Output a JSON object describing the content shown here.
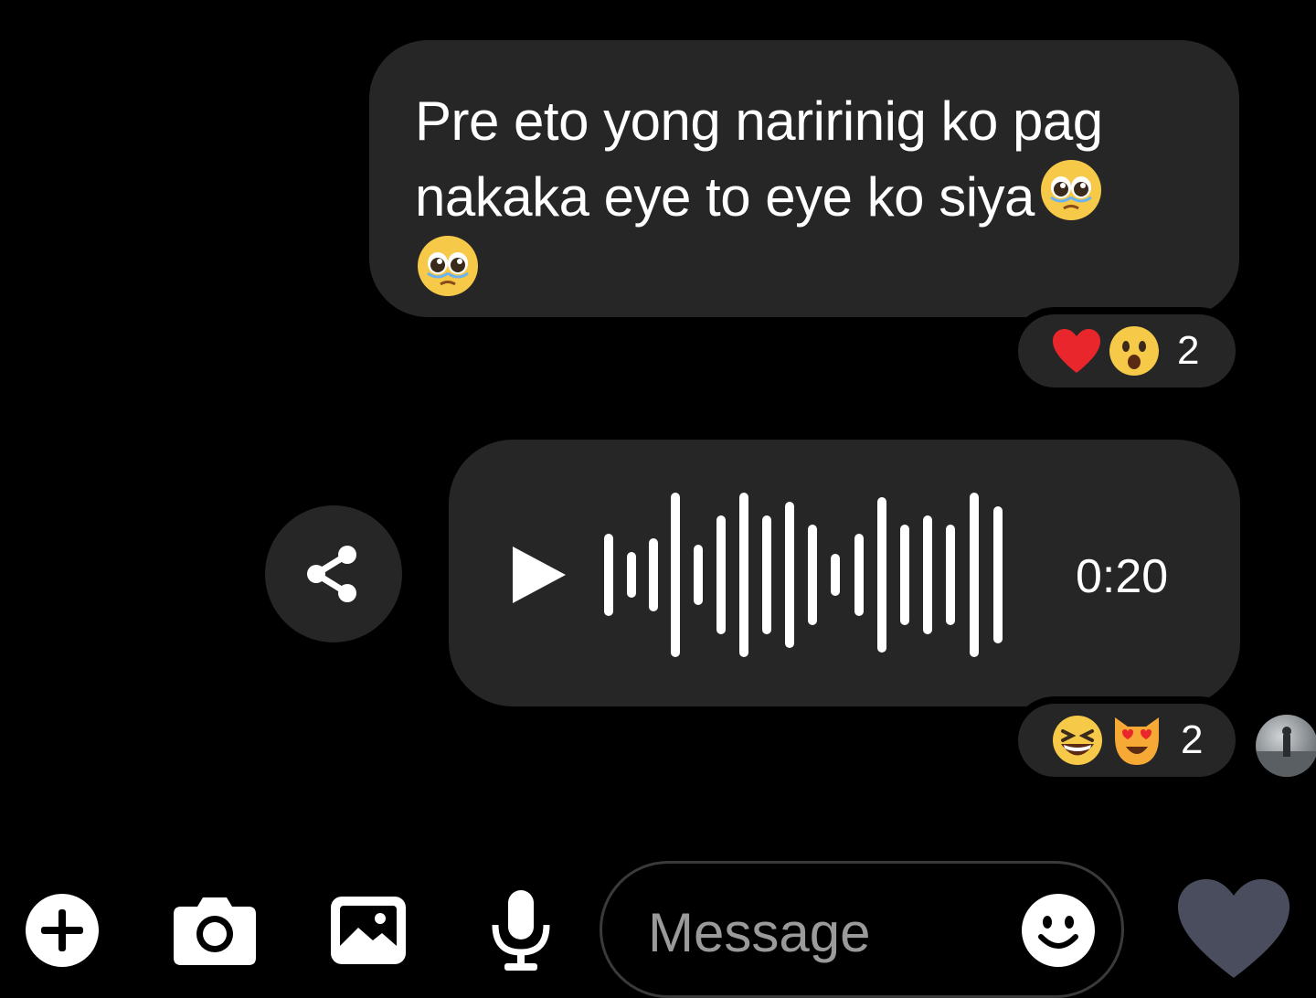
{
  "messages": [
    {
      "type": "text",
      "text": "Pre eto yong naririnig ko pag nakaka eye to eye ko siya",
      "emoji": [
        "pleading-face",
        "pleading-face"
      ],
      "reactions": {
        "icons": [
          "red-heart",
          "astonished-face"
        ],
        "count": "2"
      }
    },
    {
      "type": "voice",
      "duration": "0:20",
      "reactions": {
        "icons": [
          "grinning-squinting-face",
          "heart-eyes-cat"
        ],
        "count": "2"
      }
    }
  ],
  "composer": {
    "placeholder": "Message",
    "icons": [
      "add-icon",
      "camera-icon",
      "gallery-icon",
      "microphone-icon",
      "emoji-icon",
      "like-heart-icon"
    ]
  },
  "colors": {
    "background": "#000000",
    "bubble": "#262626",
    "text": "#ffffff",
    "placeholder": "#9a9a9a",
    "like_heart": "#4a4d5e"
  }
}
